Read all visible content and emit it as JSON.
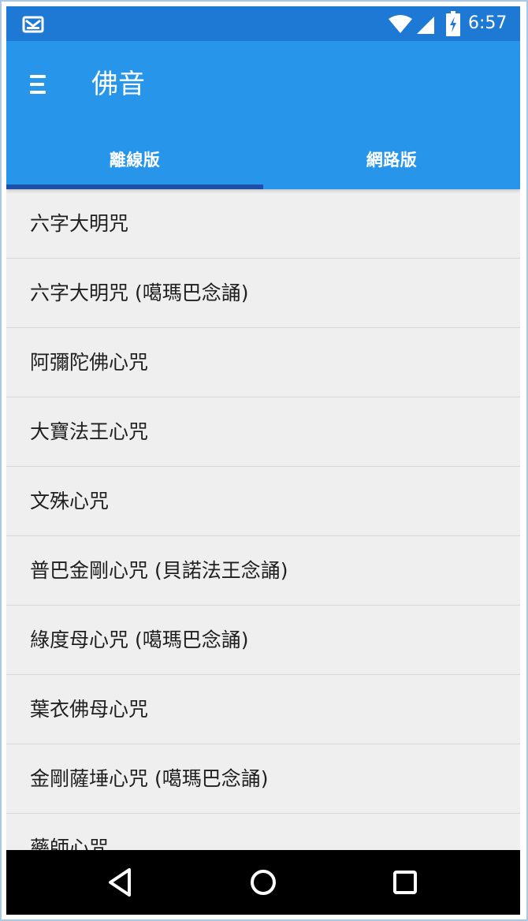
{
  "status_bar": {
    "time": "6:57",
    "icons": [
      "mail-icon",
      "wifi-icon",
      "cell-signal-icon",
      "battery-charging-icon"
    ]
  },
  "app_bar": {
    "title": "佛音",
    "menu_icon": "menu-icon"
  },
  "tabs": [
    {
      "label": "離線版",
      "selected": true
    },
    {
      "label": "網路版",
      "selected": false
    }
  ],
  "list": {
    "items": [
      "六字大明咒",
      "六字大明咒 (噶瑪巴念誦)",
      "阿彌陀佛心咒",
      "大寶法王心咒",
      "文殊心咒",
      "普巴金剛心咒 (貝諾法王念誦)",
      "綠度母心咒 (噶瑪巴念誦)",
      "葉衣佛母心咒",
      "金剛薩埵心咒 (噶瑪巴念誦)",
      "藥師心咒"
    ]
  },
  "navigation_bar": {
    "buttons": [
      "back-icon",
      "home-icon",
      "recent-apps-icon"
    ]
  },
  "colors": {
    "status_bar": "#1d79d3",
    "app_bar": "#2795ea",
    "tab_indicator": "#1d4fa8",
    "list_background": "#efefef",
    "divider": "#d7d7d7",
    "text": "#202020",
    "navigation_bar": "#000000"
  }
}
